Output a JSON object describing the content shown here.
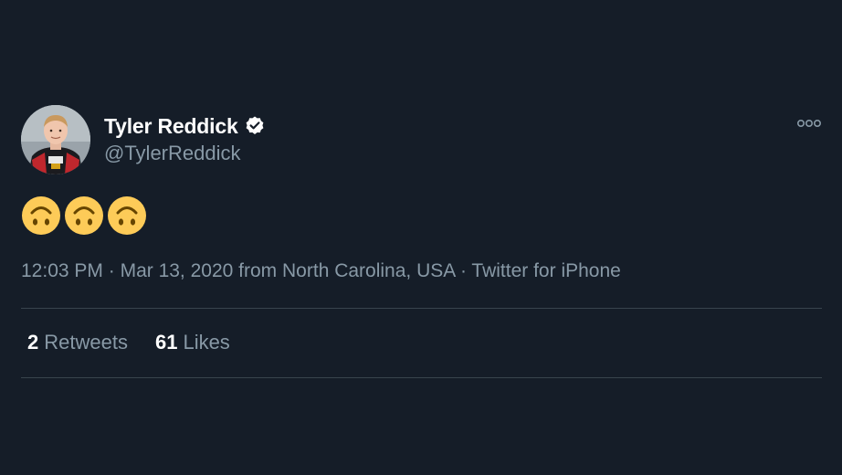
{
  "tweet": {
    "display_name": "Tyler Reddick",
    "handle": "@TylerReddick",
    "verified": true,
    "content_emojis": [
      "upside-down-face-emoji",
      "upside-down-face-emoji",
      "upside-down-face-emoji"
    ],
    "time": "12:03 PM",
    "date": "Mar 13, 2020",
    "location_prefix": "from",
    "location": "North Carolina, USA",
    "source": "Twitter for iPhone",
    "separator": "·"
  },
  "stats": {
    "retweets_count": "2",
    "retweets_label": "Retweets",
    "likes_count": "61",
    "likes_label": "Likes"
  },
  "icons": {
    "verified": "verified-badge-icon",
    "more": "more-options-icon"
  },
  "colors": {
    "background": "#151d28",
    "primary_text": "#ffffff",
    "secondary_text": "#8899a6",
    "divider": "#38444d",
    "emoji": "#fdcb58"
  }
}
